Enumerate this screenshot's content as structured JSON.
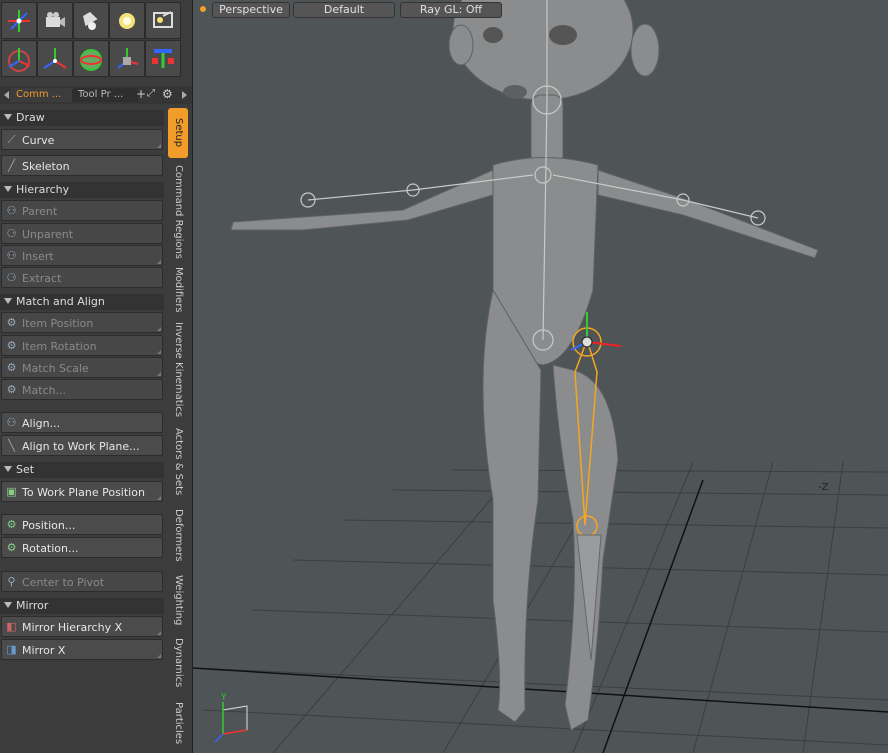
{
  "toolbar": {
    "row1": [
      "transform-icon",
      "camera-icon",
      "spotlight-icon",
      "light-bulb-icon",
      "image-icon"
    ],
    "row2": [
      "move-gizmo-icon",
      "axis-icon",
      "sphere-icon",
      "rotate-gizmo-icon",
      "item-icon"
    ]
  },
  "tabs": {
    "commands": "Comm ...",
    "toolprops": "Tool Pr ...",
    "plus": "+"
  },
  "sections": {
    "draw": "Draw",
    "hierarchy": "Hierarchy",
    "match_align": "Match and Align",
    "set": "Set",
    "mirror": "Mirror"
  },
  "buttons": {
    "curve": "Curve",
    "skeleton": "Skeleton",
    "parent": "Parent",
    "unparent": "Unparent",
    "insert": "Insert",
    "extract": "Extract",
    "item_position": "Item Position",
    "item_rotation": "Item Rotation",
    "match_scale": "Match Scale",
    "match": "Match...",
    "align": "Align...",
    "align_work_plane": "Align to Work Plane...",
    "to_work_plane_position": "To Work Plane Position",
    "position": "Position...",
    "rotation": "Rotation...",
    "center_to_pivot": "Center to Pivot",
    "mirror_hierarchy_x": "Mirror Hierarchy X",
    "mirror_x": "Mirror X"
  },
  "vertical_tabs": [
    "Setup",
    "Command Regions",
    "Modifiers",
    "Inverse Kinematics",
    "Actors & Sets",
    "Deformers",
    "Weighting",
    "Dynamics",
    "Particles"
  ],
  "viewport": {
    "view": "Perspective",
    "style": "Default",
    "raygl": "Ray GL: Off",
    "axis_y": "Y",
    "axis_z": "-Z"
  },
  "colors": {
    "accent": "#f29d2a",
    "selection": "#f5a623",
    "bg_panel": "#3c3c3c",
    "bg_viewport": "#4f5457"
  }
}
